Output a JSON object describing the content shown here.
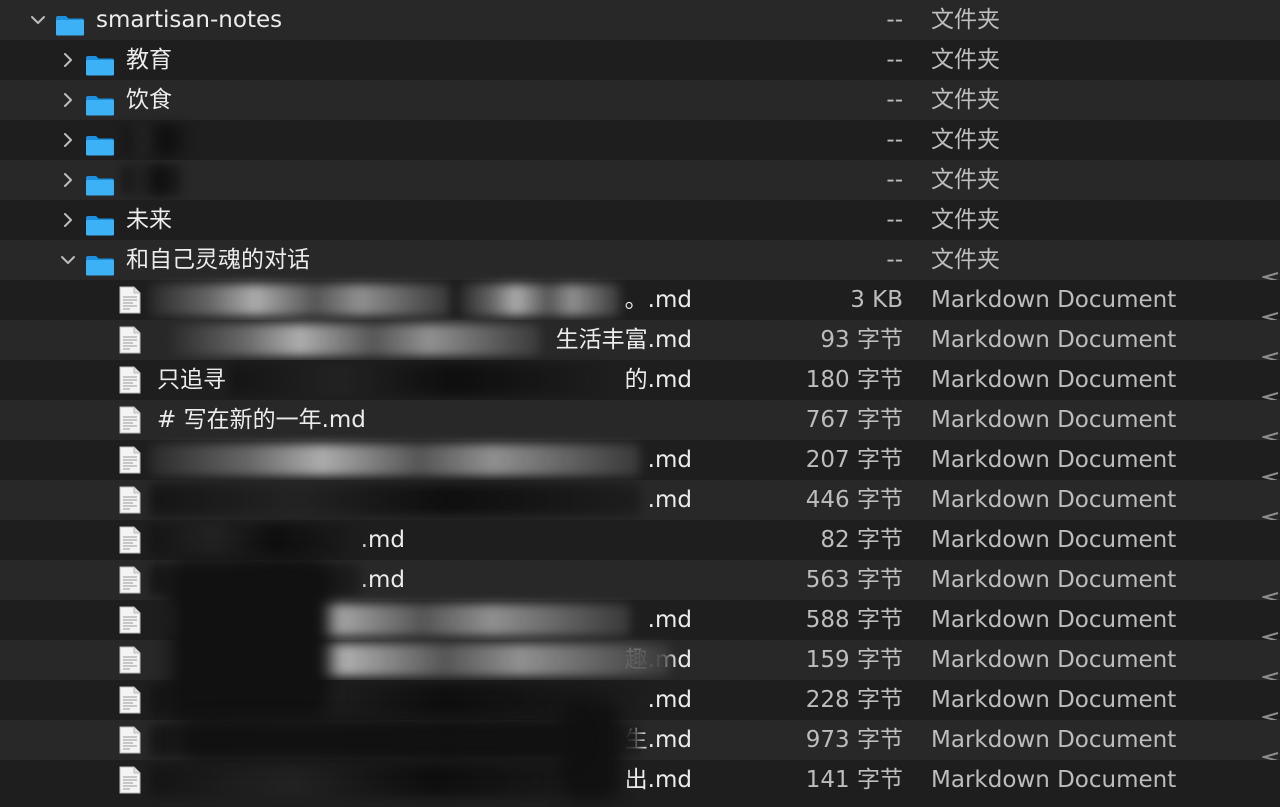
{
  "colors": {
    "background": "#1e1e1e",
    "row_alt": "#282828",
    "text": "#ececec",
    "secondary_text": "#bdbdbd",
    "folder": "#2ea7f2"
  },
  "rows": [
    {
      "type": "folder",
      "level": 0,
      "expanded": true,
      "name": "smartisan-notes",
      "size": "--",
      "kind": "文件夹"
    },
    {
      "type": "folder",
      "level": 1,
      "expanded": false,
      "name": "教育",
      "size": "--",
      "kind": "文件夹"
    },
    {
      "type": "folder",
      "level": 1,
      "expanded": false,
      "name": "饮食",
      "size": "--",
      "kind": "文件夹"
    },
    {
      "type": "folder",
      "level": 1,
      "expanded": false,
      "name": "",
      "size": "--",
      "kind": "文件夹"
    },
    {
      "type": "folder",
      "level": 1,
      "expanded": false,
      "name": "",
      "size": "--",
      "kind": "文件夹"
    },
    {
      "type": "folder",
      "level": 1,
      "expanded": false,
      "name": "未来",
      "size": "--",
      "kind": "文件夹"
    },
    {
      "type": "folder",
      "level": 1,
      "expanded": true,
      "name": "和自己灵魂的对话",
      "size": "--",
      "kind": "文件夹"
    },
    {
      "type": "file",
      "level": 2,
      "name": "。.md",
      "size": "3 KB",
      "kind": "Markdown Document"
    },
    {
      "type": "file",
      "level": 2,
      "name": "生活丰富.md",
      "size": "93 字节",
      "kind": "Markdown Document"
    },
    {
      "type": "file",
      "level": 2,
      "name": "只追寻",
      "name_end": "的.md",
      "size": "180 字节",
      "kind": "Markdown Document"
    },
    {
      "type": "file",
      "level": 2,
      "name": "# 写在新的一年.md",
      "size": "767 字节",
      "kind": "Markdown Document"
    },
    {
      "type": "file",
      "level": 2,
      "name": ".md",
      "size": "207 字节",
      "kind": "Markdown Document"
    },
    {
      "type": "file",
      "level": 2,
      "name": ".md",
      "size": "446 字节",
      "kind": "Markdown Document"
    },
    {
      "type": "file",
      "level": 2,
      "name": ".md",
      "size": "82 字节",
      "kind": "Markdown Document"
    },
    {
      "type": "file",
      "level": 2,
      "name": ".md",
      "size": "563 字节",
      "kind": "Markdown Document"
    },
    {
      "type": "file",
      "level": 2,
      "name": ".md",
      "size": "588 字节",
      "kind": "Markdown Document"
    },
    {
      "type": "file",
      "level": 2,
      "name": "趣.md",
      "size": "159 字节",
      "kind": "Markdown Document"
    },
    {
      "type": "file",
      "level": 2,
      "name": ".md",
      "size": "228 字节",
      "kind": "Markdown Document"
    },
    {
      "type": "file",
      "level": 2,
      "name": "生.md",
      "size": "973 字节",
      "kind": "Markdown Document"
    },
    {
      "type": "file",
      "level": 2,
      "name": "出.md",
      "size": "141 字节",
      "kind": "Markdown Document"
    }
  ]
}
